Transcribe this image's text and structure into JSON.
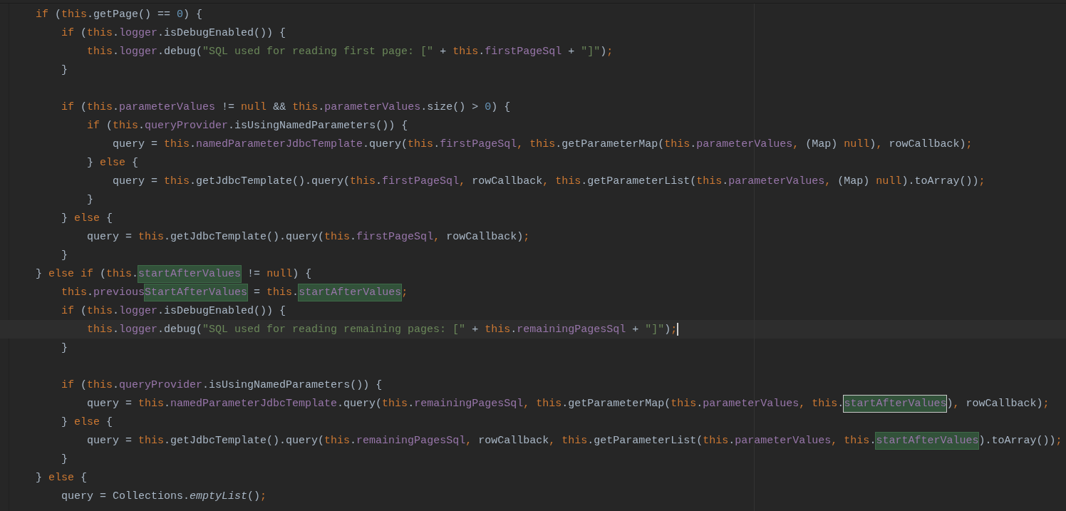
{
  "editor": {
    "lines": [
      {
        "current": false,
        "tokens": [
          {
            "kind": "keyword",
            "text": "if"
          },
          {
            "kind": "plain",
            "text": " ("
          },
          {
            "kind": "keyword",
            "text": "this"
          },
          {
            "kind": "plain",
            "text": ".getPage() == "
          },
          {
            "kind": "number",
            "text": "0"
          },
          {
            "kind": "plain",
            "text": ") {"
          }
        ],
        "children": [
          {
            "current": false,
            "tokens": [
              {
                "kind": "keyword",
                "text": "if"
              },
              {
                "kind": "plain",
                "text": " ("
              },
              {
                "kind": "keyword",
                "text": "this"
              },
              {
                "kind": "plain",
                "text": "."
              },
              {
                "kind": "field",
                "text": "logger"
              },
              {
                "kind": "plain",
                "text": ".isDebugEnabled()) {"
              }
            ],
            "children": [
              {
                "current": false,
                "tokens": [
                  {
                    "kind": "keyword",
                    "text": "this"
                  },
                  {
                    "kind": "plain",
                    "text": "."
                  },
                  {
                    "kind": "field",
                    "text": "logger"
                  },
                  {
                    "kind": "plain",
                    "text": ".debug("
                  },
                  {
                    "kind": "string",
                    "text": "\"SQL used for reading first page: [\""
                  },
                  {
                    "kind": "plain",
                    "text": " + "
                  },
                  {
                    "kind": "keyword",
                    "text": "this"
                  },
                  {
                    "kind": "plain",
                    "text": "."
                  },
                  {
                    "kind": "field",
                    "text": "firstPageSql"
                  },
                  {
                    "kind": "plain",
                    "text": " + "
                  },
                  {
                    "kind": "string",
                    "text": "\"]\""
                  },
                  {
                    "kind": "plain",
                    "text": ");"
                  }
                ]
              }
            ]
          },
          {
            "current": false,
            "tokens": [
              {
                "kind": "plain",
                "text": "}"
              }
            ]
          },
          {
            "current": false
          },
          {
            "current": false,
            "tokens": [
              {
                "kind": "keyword",
                "text": "if"
              },
              {
                "kind": "plain",
                "text": " ("
              },
              {
                "kind": "keyword",
                "text": "this"
              },
              {
                "kind": "plain",
                "text": "."
              },
              {
                "kind": "field",
                "text": "parameterValues"
              },
              {
                "kind": "plain",
                "text": " != "
              },
              {
                "kind": "keyword",
                "text": "null"
              },
              {
                "kind": "plain",
                "text": " && "
              },
              {
                "kind": "keyword",
                "text": "this"
              },
              {
                "kind": "plain",
                "text": "."
              },
              {
                "kind": "field",
                "text": "parameterValues"
              },
              {
                "kind": "plain",
                "text": ".size() > "
              },
              {
                "kind": "number",
                "text": "0"
              },
              {
                "kind": "plain",
                "text": ") {"
              }
            ],
            "children": [
              {
                "current": false,
                "tokens": [
                  {
                    "kind": "keyword",
                    "text": "if"
                  },
                  {
                    "kind": "plain",
                    "text": " ("
                  },
                  {
                    "kind": "keyword",
                    "text": "this"
                  },
                  {
                    "kind": "plain",
                    "text": "."
                  },
                  {
                    "kind": "field",
                    "text": "queryProvider"
                  },
                  {
                    "kind": "plain",
                    "text": ".isUsingNamedParameters()) {"
                  }
                ],
                "children": [
                  {
                    "current": false,
                    "tokens": [
                      {
                        "kind": "plain",
                        "text": "query = "
                      },
                      {
                        "kind": "keyword",
                        "text": "this"
                      },
                      {
                        "kind": "plain",
                        "text": "."
                      },
                      {
                        "kind": "field",
                        "text": "namedParameterJdbcTemplate"
                      },
                      {
                        "kind": "plain",
                        "text": ".query("
                      },
                      {
                        "kind": "keyword",
                        "text": "this"
                      },
                      {
                        "kind": "plain",
                        "text": "."
                      },
                      {
                        "kind": "field",
                        "text": "firstPageSql"
                      },
                      {
                        "kind": "plain",
                        "text": ", "
                      },
                      {
                        "kind": "keyword",
                        "text": "this"
                      },
                      {
                        "kind": "plain",
                        "text": ".getParameterMap("
                      },
                      {
                        "kind": "keyword",
                        "text": "this"
                      },
                      {
                        "kind": "plain",
                        "text": "."
                      },
                      {
                        "kind": "field",
                        "text": "parameterValues"
                      },
                      {
                        "kind": "plain",
                        "text": ", (Map) "
                      },
                      {
                        "kind": "keyword",
                        "text": "null"
                      },
                      {
                        "kind": "plain",
                        "text": "), rowCallback);"
                      }
                    ]
                  }
                ]
              },
              {
                "current": false,
                "tokens": [
                  {
                    "kind": "plain",
                    "text": "} "
                  },
                  {
                    "kind": "keyword",
                    "text": "else"
                  },
                  {
                    "kind": "plain",
                    "text": " {"
                  }
                ],
                "children": [
                  {
                    "current": false,
                    "tokens": [
                      {
                        "kind": "plain",
                        "text": "query = "
                      },
                      {
                        "kind": "keyword",
                        "text": "this"
                      },
                      {
                        "kind": "plain",
                        "text": ".getJdbcTemplate().query("
                      },
                      {
                        "kind": "keyword",
                        "text": "this"
                      },
                      {
                        "kind": "plain",
                        "text": "."
                      },
                      {
                        "kind": "field",
                        "text": "firstPageSql"
                      },
                      {
                        "kind": "plain",
                        "text": ", rowCallback, "
                      },
                      {
                        "kind": "keyword",
                        "text": "this"
                      },
                      {
                        "kind": "plain",
                        "text": ".getParameterList("
                      },
                      {
                        "kind": "keyword",
                        "text": "this"
                      },
                      {
                        "kind": "plain",
                        "text": "."
                      },
                      {
                        "kind": "field",
                        "text": "parameterValues"
                      },
                      {
                        "kind": "plain",
                        "text": ", (Map) "
                      },
                      {
                        "kind": "keyword",
                        "text": "null"
                      },
                      {
                        "kind": "plain",
                        "text": ").toArray());"
                      }
                    ]
                  }
                ]
              },
              {
                "current": false,
                "tokens": [
                  {
                    "kind": "plain",
                    "text": "}"
                  }
                ]
              }
            ]
          },
          {
            "current": false,
            "tokens": [
              {
                "kind": "plain",
                "text": "} "
              },
              {
                "kind": "keyword",
                "text": "else"
              },
              {
                "kind": "plain",
                "text": " {"
              }
            ],
            "children": [
              {
                "current": false,
                "tokens": [
                  {
                    "kind": "plain",
                    "text": "query = "
                  },
                  {
                    "kind": "keyword",
                    "text": "this"
                  },
                  {
                    "kind": "plain",
                    "text": ".getJdbcTemplate().query("
                  },
                  {
                    "kind": "keyword",
                    "text": "this"
                  },
                  {
                    "kind": "plain",
                    "text": "."
                  },
                  {
                    "kind": "field",
                    "text": "firstPageSql"
                  },
                  {
                    "kind": "plain",
                    "text": ", rowCallback);"
                  }
                ]
              }
            ]
          },
          {
            "current": false,
            "tokens": [
              {
                "kind": "plain",
                "text": "}"
              }
            ]
          }
        ]
      },
      {
        "current": false,
        "tokens": [
          {
            "kind": "plain",
            "text": "} "
          },
          {
            "kind": "keyword",
            "text": "else if"
          },
          {
            "kind": "plain",
            "text": " ("
          },
          {
            "kind": "keyword",
            "text": "this"
          },
          {
            "kind": "plain",
            "text": "."
          },
          {
            "kind": "match",
            "text": "startAfterValues"
          },
          {
            "kind": "plain",
            "text": " != "
          },
          {
            "kind": "keyword",
            "text": "null"
          },
          {
            "kind": "plain",
            "text": ") {"
          }
        ],
        "children": [
          {
            "current": false,
            "tokens": [
              {
                "kind": "keyword",
                "text": "this"
              },
              {
                "kind": "plain",
                "text": "."
              },
              {
                "kind": "field",
                "text": "previous"
              },
              {
                "kind": "match",
                "text": "StartAfterValues"
              },
              {
                "kind": "plain",
                "text": " = "
              },
              {
                "kind": "keyword",
                "text": "this"
              },
              {
                "kind": "plain",
                "text": "."
              },
              {
                "kind": "match",
                "text": "startAfterValues"
              },
              {
                "kind": "plain",
                "text": ";"
              }
            ]
          },
          {
            "current": false,
            "tokens": [
              {
                "kind": "keyword",
                "text": "if"
              },
              {
                "kind": "plain",
                "text": " ("
              },
              {
                "kind": "keyword",
                "text": "this"
              },
              {
                "kind": "plain",
                "text": "."
              },
              {
                "kind": "field",
                "text": "logger"
              },
              {
                "kind": "plain",
                "text": ".isDebugEnabled()) {"
              }
            ],
            "children": [
              {
                "current": true,
                "tokens": [
                  {
                    "kind": "keyword",
                    "text": "this"
                  },
                  {
                    "kind": "plain",
                    "text": "."
                  },
                  {
                    "kind": "field",
                    "text": "logger"
                  },
                  {
                    "kind": "plain",
                    "text": ".debug("
                  },
                  {
                    "kind": "string",
                    "text": "\"SQL used for reading remaining pages: [\""
                  },
                  {
                    "kind": "plain",
                    "text": " + "
                  },
                  {
                    "kind": "keyword",
                    "text": "this"
                  },
                  {
                    "kind": "plain",
                    "text": "."
                  },
                  {
                    "kind": "field",
                    "text": "remainingPagesSql"
                  },
                  {
                    "kind": "plain",
                    "text": " + "
                  },
                  {
                    "kind": "string",
                    "text": "\"]\""
                  },
                  {
                    "kind": "plain",
                    "text": ");"
                  }
                ]
              }
            ]
          },
          {
            "current": false,
            "tokens": [
              {
                "kind": "plain",
                "text": "}"
              }
            ]
          },
          {
            "current": false
          },
          {
            "current": false,
            "tokens": [
              {
                "kind": "keyword",
                "text": "if"
              },
              {
                "kind": "plain",
                "text": " ("
              },
              {
                "kind": "keyword",
                "text": "this"
              },
              {
                "kind": "plain",
                "text": "."
              },
              {
                "kind": "field",
                "text": "queryProvider"
              },
              {
                "kind": "plain",
                "text": ".isUsingNamedParameters()) {"
              }
            ],
            "children": [
              {
                "current": false,
                "tokens": [
                  {
                    "kind": "plain",
                    "text": "query = "
                  },
                  {
                    "kind": "keyword",
                    "text": "this"
                  },
                  {
                    "kind": "plain",
                    "text": "."
                  },
                  {
                    "kind": "field",
                    "text": "namedParameterJdbcTemplate"
                  },
                  {
                    "kind": "plain",
                    "text": ".query("
                  },
                  {
                    "kind": "keyword",
                    "text": "this"
                  },
                  {
                    "kind": "plain",
                    "text": "."
                  },
                  {
                    "kind": "field",
                    "text": "remainingPagesSql"
                  },
                  {
                    "kind": "plain",
                    "text": ", "
                  },
                  {
                    "kind": "keyword",
                    "text": "this"
                  },
                  {
                    "kind": "plain",
                    "text": ".getParameterMap("
                  },
                  {
                    "kind": "keyword",
                    "text": "this"
                  },
                  {
                    "kind": "plain",
                    "text": "."
                  },
                  {
                    "kind": "field",
                    "text": "parameterValues"
                  },
                  {
                    "kind": "plain",
                    "text": ", "
                  },
                  {
                    "kind": "keyword",
                    "text": "this"
                  },
                  {
                    "kind": "plain",
                    "text": "."
                  },
                  {
                    "kind": "match-selected",
                    "text": "startAfterValues"
                  },
                  {
                    "kind": "plain",
                    "text": "), rowCallback);"
                  }
                ]
              }
            ]
          },
          {
            "current": false,
            "tokens": [
              {
                "kind": "plain",
                "text": "} "
              },
              {
                "kind": "keyword",
                "text": "else"
              },
              {
                "kind": "plain",
                "text": " {"
              }
            ],
            "children": [
              {
                "current": false,
                "tokens": [
                  {
                    "kind": "plain",
                    "text": "query = "
                  },
                  {
                    "kind": "keyword",
                    "text": "this"
                  },
                  {
                    "kind": "plain",
                    "text": ".getJdbcTemplate().query("
                  },
                  {
                    "kind": "keyword",
                    "text": "this"
                  },
                  {
                    "kind": "plain",
                    "text": "."
                  },
                  {
                    "kind": "field",
                    "text": "remainingPagesSql"
                  },
                  {
                    "kind": "plain",
                    "text": ", rowCallback, "
                  },
                  {
                    "kind": "keyword",
                    "text": "this"
                  },
                  {
                    "kind": "plain",
                    "text": ".getParameterList("
                  },
                  {
                    "kind": "keyword",
                    "text": "this"
                  },
                  {
                    "kind": "plain",
                    "text": "."
                  },
                  {
                    "kind": "field",
                    "text": "parameterValues"
                  },
                  {
                    "kind": "plain",
                    "text": ", "
                  },
                  {
                    "kind": "keyword",
                    "text": "this"
                  },
                  {
                    "kind": "plain",
                    "text": "."
                  },
                  {
                    "kind": "match",
                    "text": "startAfterValues"
                  },
                  {
                    "kind": "plain",
                    "text": ").toArray());"
                  }
                ]
              }
            ]
          },
          {
            "current": false,
            "tokens": [
              {
                "kind": "plain",
                "text": "}"
              }
            ]
          }
        ]
      },
      {
        "current": false,
        "tokens": [
          {
            "kind": "plain",
            "text": "} "
          },
          {
            "kind": "keyword",
            "text": "else"
          },
          {
            "kind": "plain",
            "text": " {"
          }
        ],
        "children": [
          {
            "current": false,
            "tokens": [
              {
                "kind": "plain",
                "text": "query = Collections."
              },
              {
                "kind": "static-method",
                "text": "emptyList"
              },
              {
                "kind": "plain",
                "text": "();"
              }
            ]
          }
        ]
      }
    ]
  }
}
